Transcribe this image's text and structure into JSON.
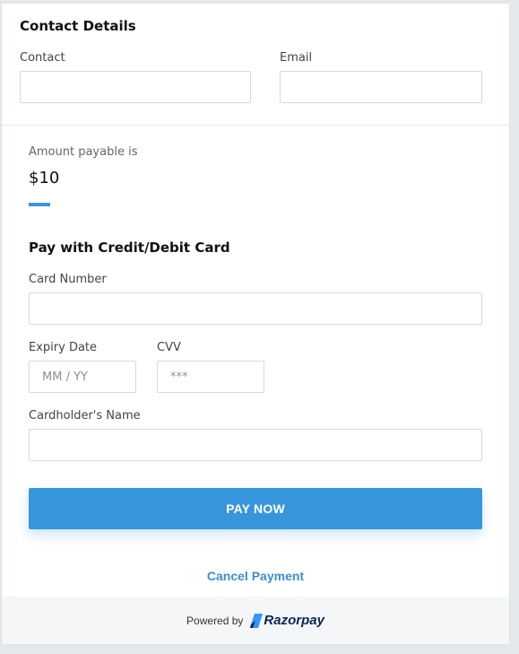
{
  "contact": {
    "title": "Contact Details",
    "contact_label": "Contact",
    "contact_value": "",
    "email_label": "Email",
    "email_value": ""
  },
  "amount": {
    "label": "Amount payable is",
    "value": "$10"
  },
  "card": {
    "title": "Pay with Credit/Debit Card",
    "number_label": "Card Number",
    "number_value": "",
    "expiry_label": "Expiry Date",
    "expiry_placeholder": "MM / YY",
    "cvv_label": "CVV",
    "cvv_placeholder": "***",
    "name_label": "Cardholder's Name",
    "name_value": ""
  },
  "actions": {
    "pay_label": "PAY NOW",
    "cancel_label": "Cancel Payment"
  },
  "footer": {
    "powered_by": "Powered by",
    "brand": "Razorpay"
  },
  "colors": {
    "accent": "#3796db",
    "brand_navy": "#072654",
    "brand_blue": "#3395ff",
    "page_background": "#e6e9ec",
    "footer_background": "#f4f6f8"
  },
  "icons": {
    "brand_logo": "razorpay-logo-icon"
  }
}
